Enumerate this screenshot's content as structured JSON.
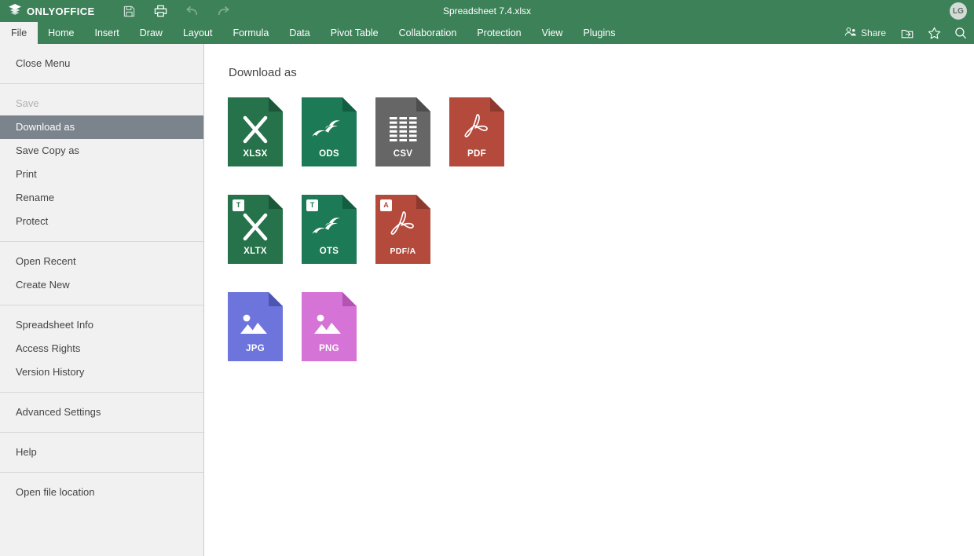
{
  "header": {
    "brand": "ONLYOFFICE",
    "document_title": "Spreadsheet 7.4.xlsx",
    "avatar_initials": "LG",
    "quick_tools": [
      {
        "name": "save-icon",
        "tooltip": "Save"
      },
      {
        "name": "print-icon",
        "tooltip": "Print"
      },
      {
        "name": "undo-icon",
        "tooltip": "Undo"
      },
      {
        "name": "redo-icon",
        "tooltip": "Redo"
      }
    ],
    "share_label": "Share",
    "right_icons": [
      {
        "name": "open-location-icon"
      },
      {
        "name": "favorite-star-icon"
      },
      {
        "name": "search-icon"
      }
    ]
  },
  "tabs": [
    {
      "label": "File",
      "active": true
    },
    {
      "label": "Home",
      "active": false
    },
    {
      "label": "Insert",
      "active": false
    },
    {
      "label": "Draw",
      "active": false
    },
    {
      "label": "Layout",
      "active": false
    },
    {
      "label": "Formula",
      "active": false
    },
    {
      "label": "Data",
      "active": false
    },
    {
      "label": "Pivot Table",
      "active": false
    },
    {
      "label": "Collaboration",
      "active": false
    },
    {
      "label": "Protection",
      "active": false
    },
    {
      "label": "View",
      "active": false
    },
    {
      "label": "Plugins",
      "active": false
    }
  ],
  "file_menu": {
    "groups": [
      {
        "items": [
          {
            "label": "Close Menu",
            "state": "normal"
          }
        ]
      },
      {
        "items": [
          {
            "label": "Save",
            "state": "disabled"
          },
          {
            "label": "Download as",
            "state": "selected"
          },
          {
            "label": "Save Copy as",
            "state": "normal"
          },
          {
            "label": "Print",
            "state": "normal"
          },
          {
            "label": "Rename",
            "state": "normal"
          },
          {
            "label": "Protect",
            "state": "normal"
          }
        ]
      },
      {
        "items": [
          {
            "label": "Open Recent",
            "state": "normal"
          },
          {
            "label": "Create New",
            "state": "normal"
          }
        ]
      },
      {
        "items": [
          {
            "label": "Spreadsheet Info",
            "state": "normal"
          },
          {
            "label": "Access Rights",
            "state": "normal"
          },
          {
            "label": "Version History",
            "state": "normal"
          }
        ]
      },
      {
        "items": [
          {
            "label": "Advanced Settings",
            "state": "normal"
          }
        ]
      },
      {
        "items": [
          {
            "label": "Help",
            "state": "normal"
          }
        ]
      },
      {
        "items": [
          {
            "label": "Open file location",
            "state": "normal"
          }
        ]
      }
    ]
  },
  "main": {
    "title": "Download as",
    "rows": [
      [
        {
          "label": "XLSX",
          "glyph": "x-letter",
          "color": "#26724A",
          "fold": "#1C573A",
          "badge": null
        },
        {
          "label": "ODS",
          "glyph": "seagulls",
          "color": "#1D7A56",
          "fold": "#125E41",
          "badge": null
        },
        {
          "label": "CSV",
          "glyph": "grid",
          "color": "#666666",
          "fold": "#4D4D4D",
          "badge": null
        },
        {
          "label": "PDF",
          "glyph": "pdf-swirl",
          "color": "#B34A3C",
          "fold": "#8E392E",
          "badge": null
        }
      ],
      [
        {
          "label": "XLTX",
          "glyph": "x-letter",
          "color": "#26724A",
          "fold": "#1C573A",
          "badge": {
            "text": "T",
            "color": "#26724A"
          }
        },
        {
          "label": "OTS",
          "glyph": "seagulls",
          "color": "#1D7A56",
          "fold": "#125E41",
          "badge": {
            "text": "T",
            "color": "#1D7A56"
          }
        },
        {
          "label": "PDF/A",
          "glyph": "pdf-swirl",
          "color": "#B34A3C",
          "fold": "#8E392E",
          "badge": {
            "text": "A",
            "color": "#B34A3C"
          }
        }
      ],
      [
        {
          "label": "JPG",
          "glyph": "image",
          "color": "#6D74DB",
          "fold": "#4C55B0",
          "badge": null
        },
        {
          "label": "PNG",
          "glyph": "image",
          "color": "#D673D6",
          "fold": "#B254B2",
          "badge": null
        }
      ]
    ]
  },
  "colors": {
    "header_green": "#3D8159",
    "menu_bg": "#F1F1F1",
    "menu_selected": "#7B838C",
    "text": "#444444"
  }
}
